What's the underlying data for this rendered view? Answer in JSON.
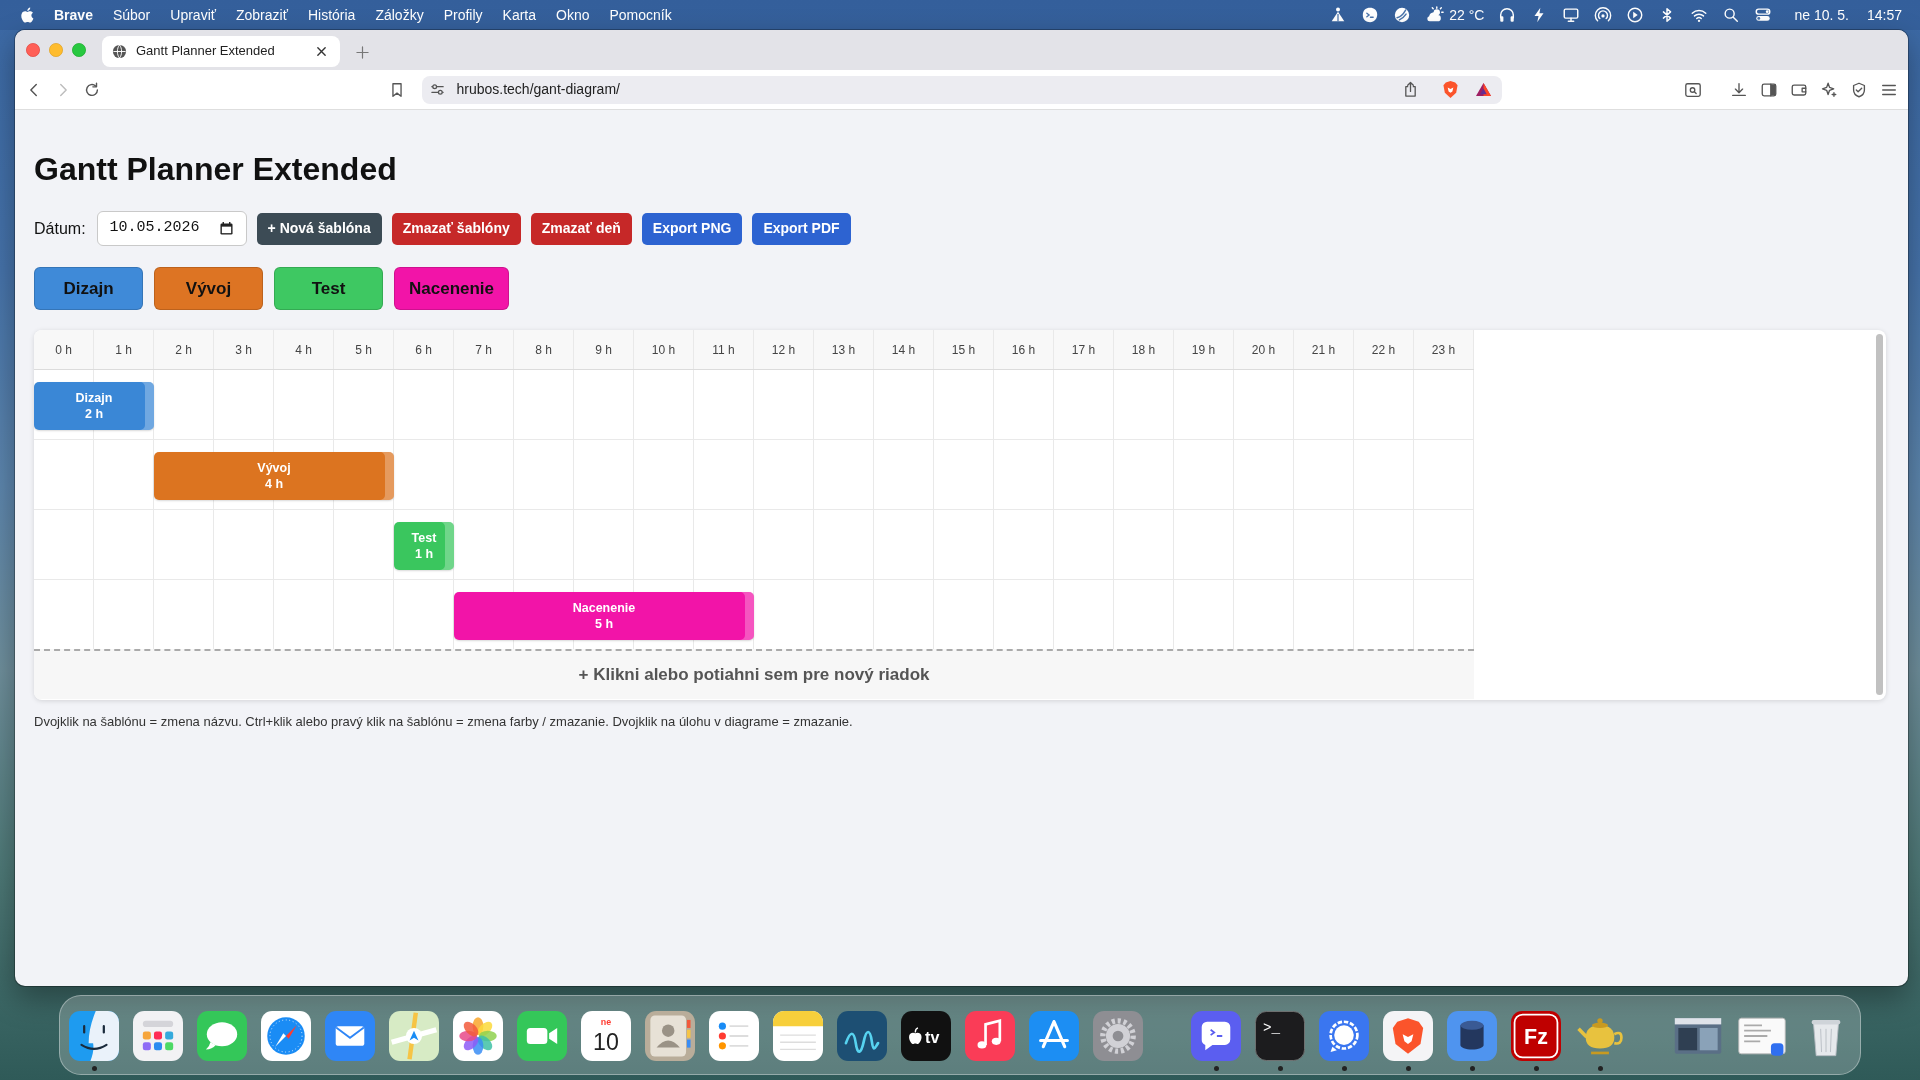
{
  "menu_bar": {
    "app_name": "Brave",
    "menus": [
      "Súbor",
      "Upraviť",
      "Zobraziť",
      "História",
      "Záložky",
      "Profily",
      "Karta",
      "Okno",
      "Pomocník"
    ],
    "weather": "22 °C",
    "date": "ne 10. 5.",
    "time": "14:57"
  },
  "browser": {
    "tabs": [
      {
        "title": "Gantt Planner Extended",
        "selected": true
      }
    ],
    "back_disabled": false,
    "forward_disabled": true,
    "url": "hrubos.tech/gant-diagram/"
  },
  "page": {
    "title": "Gantt Planner Extended",
    "date_label": "Dátum:",
    "date_value": "10.05.2026",
    "buttons": [
      {
        "label": "+ Nová šablóna",
        "kind": "neutral"
      },
      {
        "label": "Zmazať šablóny",
        "kind": "danger"
      },
      {
        "label": "Zmazať deň",
        "kind": "danger"
      },
      {
        "label": "Export PNG",
        "kind": "export"
      },
      {
        "label": "Export PDF",
        "kind": "export"
      }
    ],
    "templates": [
      {
        "name": "Dizajn",
        "color": "#3f8ad8"
      },
      {
        "name": "Vývoj",
        "color": "#dd7423"
      },
      {
        "name": "Test",
        "color": "#3ec862"
      },
      {
        "name": "Nacenenie",
        "color": "#f214a8"
      }
    ],
    "gantt": {
      "hours": [
        "0 h",
        "1 h",
        "2 h",
        "3 h",
        "4 h",
        "5 h",
        "6 h",
        "7 h",
        "8 h",
        "9 h",
        "10 h",
        "11 h",
        "12 h",
        "13 h",
        "14 h",
        "15 h",
        "16 h",
        "17 h",
        "18 h",
        "19 h",
        "20 h",
        "21 h",
        "22 h",
        "23 h"
      ],
      "rows": [
        {
          "cells": [
            {
              "kind": "task",
              "name": "Dizajn",
              "duration": "2 h",
              "color": "#3a87d6"
            },
            {
              "kind": "task_span"
            },
            {
              "kind": "empty"
            },
            {
              "kind": "empty"
            },
            {
              "kind": "empty"
            },
            {
              "kind": "empty"
            },
            {
              "kind": "empty"
            },
            {
              "kind": "empty"
            },
            {
              "kind": "empty"
            },
            {
              "kind": "empty"
            },
            {
              "kind": "empty"
            },
            {
              "kind": "empty"
            },
            {
              "kind": "empty"
            },
            {
              "kind": "empty"
            },
            {
              "kind": "empty"
            },
            {
              "kind": "empty"
            },
            {
              "kind": "empty"
            },
            {
              "kind": "empty"
            },
            {
              "kind": "empty"
            },
            {
              "kind": "empty"
            },
            {
              "kind": "empty"
            },
            {
              "kind": "empty"
            },
            {
              "kind": "empty"
            },
            {
              "kind": "empty"
            }
          ]
        },
        {
          "cells": [
            {
              "kind": "empty"
            },
            {
              "kind": "empty"
            },
            {
              "kind": "task",
              "name": "Vývoj",
              "duration": "4 h",
              "color": "#dc7420"
            },
            {
              "kind": "task_span"
            },
            {
              "kind": "task_span"
            },
            {
              "kind": "task_span"
            },
            {
              "kind": "empty"
            },
            {
              "kind": "empty"
            },
            {
              "kind": "empty"
            },
            {
              "kind": "empty"
            },
            {
              "kind": "empty"
            },
            {
              "kind": "empty"
            },
            {
              "kind": "empty"
            },
            {
              "kind": "empty"
            },
            {
              "kind": "empty"
            },
            {
              "kind": "empty"
            },
            {
              "kind": "empty"
            },
            {
              "kind": "empty"
            },
            {
              "kind": "empty"
            },
            {
              "kind": "empty"
            },
            {
              "kind": "empty"
            },
            {
              "kind": "empty"
            },
            {
              "kind": "empty"
            },
            {
              "kind": "empty"
            }
          ]
        },
        {
          "cells": [
            {
              "kind": "empty"
            },
            {
              "kind": "empty"
            },
            {
              "kind": "empty"
            },
            {
              "kind": "empty"
            },
            {
              "kind": "empty"
            },
            {
              "kind": "empty"
            },
            {
              "kind": "task",
              "name": "Test",
              "duration": "1 h",
              "color": "#3ac65e"
            },
            {
              "kind": "empty"
            },
            {
              "kind": "empty"
            },
            {
              "kind": "empty"
            },
            {
              "kind": "empty"
            },
            {
              "kind": "empty"
            },
            {
              "kind": "empty"
            },
            {
              "kind": "empty"
            },
            {
              "kind": "empty"
            },
            {
              "kind": "empty"
            },
            {
              "kind": "empty"
            },
            {
              "kind": "empty"
            },
            {
              "kind": "empty"
            },
            {
              "kind": "empty"
            },
            {
              "kind": "empty"
            },
            {
              "kind": "empty"
            },
            {
              "kind": "empty"
            },
            {
              "kind": "empty"
            }
          ]
        },
        {
          "cells": [
            {
              "kind": "empty"
            },
            {
              "kind": "empty"
            },
            {
              "kind": "empty"
            },
            {
              "kind": "empty"
            },
            {
              "kind": "empty"
            },
            {
              "kind": "empty"
            },
            {
              "kind": "empty"
            },
            {
              "kind": "task",
              "name": "Nacenenie",
              "duration": "5 h",
              "color": "#f214a8"
            },
            {
              "kind": "task_span"
            },
            {
              "kind": "task_span"
            },
            {
              "kind": "task_span"
            },
            {
              "kind": "task_span"
            },
            {
              "kind": "empty"
            },
            {
              "kind": "empty"
            },
            {
              "kind": "empty"
            },
            {
              "kind": "empty"
            },
            {
              "kind": "empty"
            },
            {
              "kind": "empty"
            },
            {
              "kind": "empty"
            },
            {
              "kind": "empty"
            },
            {
              "kind": "empty"
            },
            {
              "kind": "empty"
            },
            {
              "kind": "empty"
            },
            {
              "kind": "empty"
            }
          ]
        }
      ],
      "add_row": "+ Klikni alebo potiahni sem pre nový riadok"
    },
    "hint": "Dvojklik na šablónu = zmena názvu. Ctrl+klik alebo pravý klik na šablónu = zmena farby / zmazanie. Dvojklik na úlohu v diagrame = zmazanie."
  },
  "dock": {
    "sections": [
      {
        "items": [
          {
            "kind": "finder",
            "running": true
          },
          {
            "kind": "launchpad",
            "running": false
          },
          {
            "kind": "messages",
            "running": false
          },
          {
            "kind": "safari",
            "running": false
          },
          {
            "kind": "mail",
            "running": false
          },
          {
            "kind": "maps",
            "running": false
          },
          {
            "kind": "photos",
            "running": false
          },
          {
            "kind": "facetime",
            "running": false
          },
          {
            "kind": "calendar",
            "running": false,
            "weekday": "ne",
            "day": "10"
          },
          {
            "kind": "contacts",
            "running": false
          },
          {
            "kind": "reminders",
            "running": false
          },
          {
            "kind": "notes",
            "running": false
          },
          {
            "kind": "freeform",
            "running": false
          },
          {
            "kind": "tv",
            "running": false,
            "icon_text": "tv"
          },
          {
            "kind": "music",
            "running": false
          },
          {
            "kind": "appstore",
            "running": false
          },
          {
            "kind": "settings",
            "running": false
          }
        ]
      },
      {
        "items": [
          {
            "kind": "chat-prompt",
            "running": true
          },
          {
            "kind": "terminal",
            "running": true,
            "icon_text": ">_"
          },
          {
            "kind": "signal",
            "running": true
          },
          {
            "kind": "brave",
            "running": true
          },
          {
            "kind": "database",
            "running": true
          },
          {
            "kind": "filezilla",
            "running": true,
            "icon_text": "Fz"
          },
          {
            "kind": "teapot",
            "running": true
          }
        ]
      },
      {
        "items": [
          {
            "kind": "photo-window"
          },
          {
            "kind": "document-window"
          },
          {
            "kind": "trash"
          }
        ]
      }
    ]
  }
}
